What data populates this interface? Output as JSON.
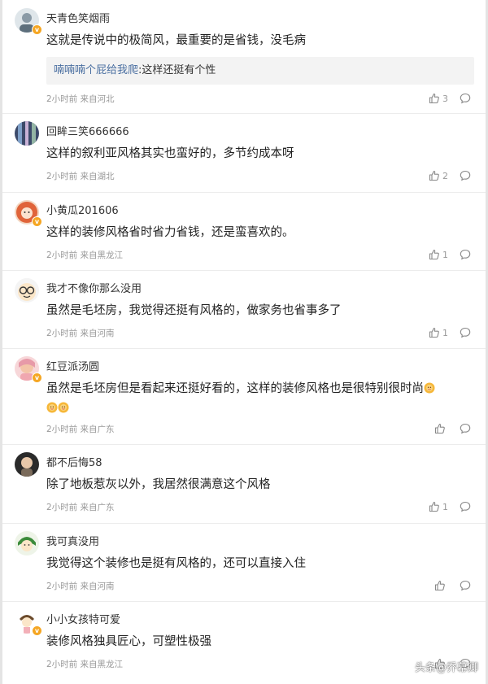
{
  "comments": [
    {
      "username": "天青色笑烟雨",
      "text": "这就是传说中的极简风，最重要的是省钱，没毛病",
      "reply": {
        "user": "喃喃喃个屁给我爬",
        "text": ":这样还挺有个性"
      },
      "meta": "2小时前 来自河北",
      "likes": "3",
      "verified": true
    },
    {
      "username": "回眸三笑666666",
      "text": "这样的叙利亚风格其实也蛮好的，多节约成本呀",
      "meta": "2小时前 来自湖北",
      "likes": "2",
      "verified": false
    },
    {
      "username": "小黄瓜201606",
      "text": "这样的装修风格省时省力省钱，还是蛮喜欢的。",
      "meta": "2小时前 来自黑龙江",
      "likes": "1",
      "verified": true
    },
    {
      "username": "我才不像你那么没用",
      "text": "虽然是毛坯房，我觉得还挺有风格的，做家务也省事多了",
      "meta": "2小时前 来自河南",
      "likes": "1",
      "verified": false
    },
    {
      "username": "红豆派汤圆",
      "text": "虽然是毛坯房但是看起来还挺好看的，这样的装修风格也是很特别很时尚",
      "meta": "2小时前 来自广东",
      "likes": "",
      "verified": true
    },
    {
      "username": "都不后悔58",
      "text": "除了地板惹灰以外，我居然很满意这个风格",
      "meta": "2小时前 来自广东",
      "likes": "1",
      "verified": false
    },
    {
      "username": "我可真没用",
      "text": "我觉得这个装修也是挺有风格的，还可以直接入住",
      "meta": "2小时前 来自河南",
      "likes": "",
      "verified": false
    },
    {
      "username": "小小女孩特可爱",
      "text": "装修风格独具匠心，可塑性极强",
      "meta": "2小时前 来自黑龙江",
      "likes": "",
      "verified": true
    }
  ],
  "watermark": "头条@乔幕卿",
  "icons": {
    "like": "thumbs-up-icon",
    "reply": "comment-bubble-icon",
    "emoji": "sunflower-face-emoji"
  },
  "colors": {
    "reply_user": "#4a6fa1",
    "meta": "#999999",
    "badge": "#f5a623"
  }
}
